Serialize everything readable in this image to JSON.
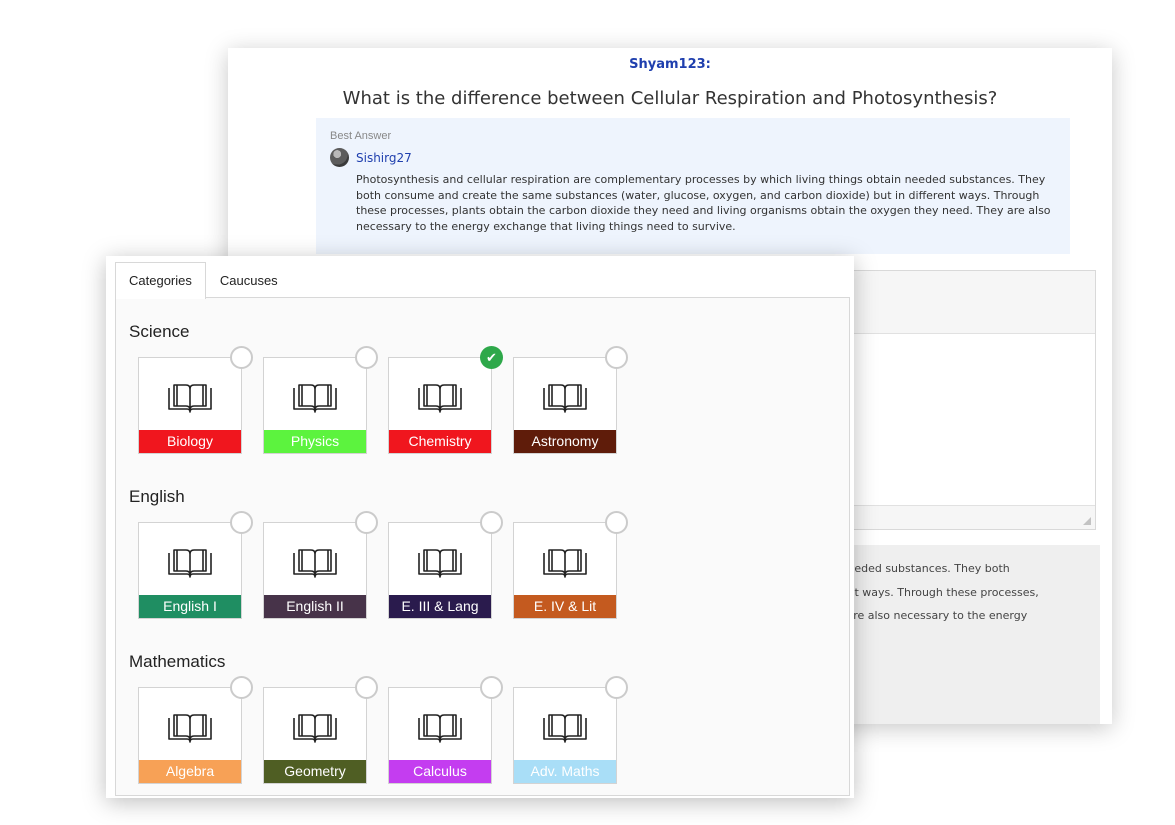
{
  "question_view": {
    "asker": "Shyam123:",
    "question": "What is the difference between Cellular Respiration and Photosynthesis?",
    "best_answer_label": "Best Answer",
    "answerer": "Sishirg27",
    "answer_lines": [
      "Photosynthesis and cellular respiration are complementary processes by which living things obtain needed substances. They",
      "both consume and create the same substances (water, glucose, oxygen, and carbon dioxide) but in different ways. Through",
      "these processes, plants obtain the carbon dioxide they need and living organisms obtain the oxygen they need. They are also",
      "necessary to the energy exchange that living things need to survive."
    ],
    "preview_lines": [
      "tain needed substances. They both",
      "lifferent ways. Through these processes,",
      "They are also necessary to the energy"
    ]
  },
  "category_picker": {
    "tabs": [
      {
        "label": "Categories",
        "active": true
      },
      {
        "label": "Caucuses",
        "active": false
      }
    ],
    "sections": [
      {
        "title": "Science",
        "items": [
          {
            "label": "Biology",
            "color": "#f0161e",
            "selected": false
          },
          {
            "label": "Physics",
            "color": "#5cf33e",
            "selected": false
          },
          {
            "label": "Chemistry",
            "color": "#f0161e",
            "selected": true
          },
          {
            "label": "Astronomy",
            "color": "#5f1c0a",
            "selected": false
          }
        ]
      },
      {
        "title": "English",
        "items": [
          {
            "label": "English I",
            "color": "#1f8e62",
            "selected": false
          },
          {
            "label": "English II",
            "color": "#473349",
            "selected": false
          },
          {
            "label": "E. III & Lang",
            "color": "#2a1b4d",
            "selected": false
          },
          {
            "label": "E. IV & Lit",
            "color": "#c45a1f",
            "selected": false
          }
        ]
      },
      {
        "title": "Mathematics",
        "items": [
          {
            "label": "Algebra",
            "color": "#f7a156",
            "selected": false
          },
          {
            "label": "Geometry",
            "color": "#4f5e23",
            "selected": false
          },
          {
            "label": "Calculus",
            "color": "#c43df0",
            "selected": false
          },
          {
            "label": "Adv. Maths",
            "color": "#a9def7",
            "selected": false
          }
        ]
      }
    ],
    "icon": "open-book-icon",
    "check_icon": "checkmark-icon"
  }
}
